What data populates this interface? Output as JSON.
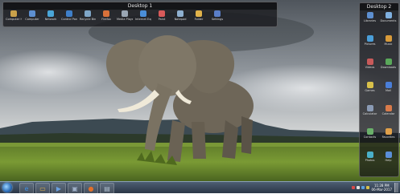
{
  "desktop1": {
    "title": "Desktop 1",
    "icons": [
      {
        "label": "Computer Home",
        "color": "#c9a14a"
      },
      {
        "label": "Computer",
        "color": "#5d8fd0"
      },
      {
        "label": "Network",
        "color": "#4aa6d8"
      },
      {
        "label": "Control Panel",
        "color": "#3f7fc9"
      },
      {
        "label": "Recycle Bin",
        "color": "#7fa6c8"
      },
      {
        "label": "Firefox",
        "color": "#d8713a"
      },
      {
        "label": "Media Player",
        "color": "#9aa6b4"
      },
      {
        "label": "Internet Explorer",
        "color": "#4a8ed8"
      },
      {
        "label": "Paint",
        "color": "#d85a5a"
      },
      {
        "label": "Notepad",
        "color": "#8fb0d0"
      },
      {
        "label": "Folder",
        "color": "#e0b24a"
      },
      {
        "label": "Settings",
        "color": "#5a7ec8"
      }
    ]
  },
  "desktop2": {
    "title": "Desktop 2",
    "icons": [
      {
        "label": "Libraries",
        "color": "#5d8fd0"
      },
      {
        "label": "Documents",
        "color": "#7fb0e0"
      },
      {
        "label": "Pictures",
        "color": "#4a9ed8"
      },
      {
        "label": "Music",
        "color": "#d89a3a"
      },
      {
        "label": "Videos",
        "color": "#c85a5a"
      },
      {
        "label": "Downloads",
        "color": "#5aa85a"
      },
      {
        "label": "Games",
        "color": "#d8c04a"
      },
      {
        "label": "Mail",
        "color": "#4a7ed8"
      },
      {
        "label": "Calculator",
        "color": "#8a9ab4"
      },
      {
        "label": "Calendar",
        "color": "#d87a4a"
      },
      {
        "label": "Contacts",
        "color": "#6ab06a"
      },
      {
        "label": "Favorites",
        "color": "#e0a04a"
      },
      {
        "label": "Photos",
        "color": "#4ab0c8"
      },
      {
        "label": "Help",
        "color": "#5a8ed8"
      }
    ]
  },
  "taskbar": {
    "pinned": [
      {
        "name": "internet-explorer",
        "glyph": "e",
        "color": "#3f8fe0"
      },
      {
        "name": "explorer",
        "glyph": "▭",
        "color": "#e0b24a"
      },
      {
        "name": "media-player",
        "glyph": "▶",
        "color": "#6aa0e0"
      },
      {
        "name": "window-manager",
        "glyph": "▣",
        "color": "#9fb0c8"
      },
      {
        "name": "firefox",
        "glyph": "●",
        "color": "#e0702a"
      },
      {
        "name": "monitor",
        "glyph": "▤",
        "color": "#b0c0d0"
      }
    ],
    "clock_time": "11:28 PM",
    "clock_date": "06-Mar-2017",
    "tray_colors": [
      "#d84a4a",
      "#e0e0e0",
      "#5aa0e0",
      "#d8c04a"
    ]
  },
  "colors": {
    "sky_top": "#5a6068",
    "sky_bottom": "#c8ccd0",
    "grass": "#6a8a2a"
  }
}
